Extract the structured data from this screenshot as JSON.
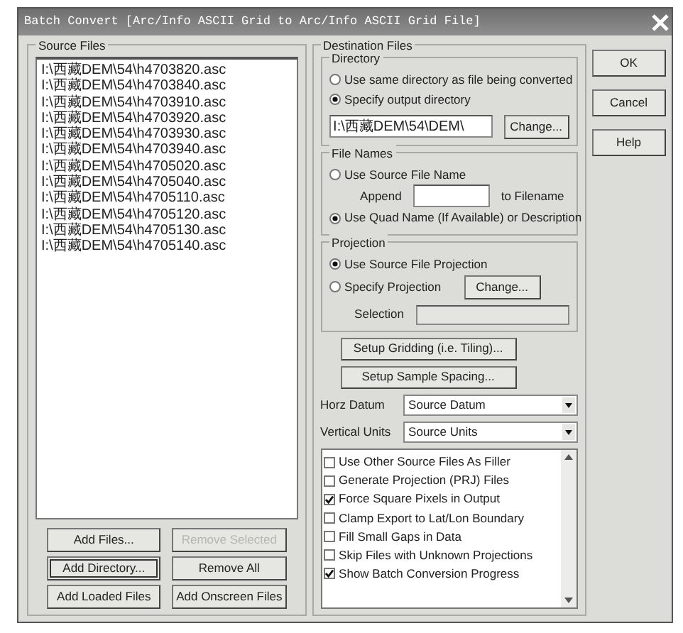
{
  "window": {
    "title": "Batch Convert [Arc/Info ASCII Grid to Arc/Info ASCII Grid File]"
  },
  "source_files": {
    "label": "Source Files",
    "files": [
      "I:\\西藏DEM\\54\\h4703820.asc",
      "I:\\西藏DEM\\54\\h4703840.asc",
      "I:\\西藏DEM\\54\\h4703910.asc",
      "I:\\西藏DEM\\54\\h4703920.asc",
      "I:\\西藏DEM\\54\\h4703930.asc",
      "I:\\西藏DEM\\54\\h4703940.asc",
      "I:\\西藏DEM\\54\\h4705020.asc",
      "I:\\西藏DEM\\54\\h4705040.asc",
      "I:\\西藏DEM\\54\\h4705110.asc",
      "I:\\西藏DEM\\54\\h4705120.asc",
      "I:\\西藏DEM\\54\\h4705130.asc",
      "I:\\西藏DEM\\54\\h4705140.asc"
    ],
    "buttons": [
      {
        "label": "Add Files...",
        "disabled": false,
        "focused": false
      },
      {
        "label": "Remove Selected",
        "disabled": true,
        "focused": false
      },
      {
        "label": "Add Directory...",
        "disabled": false,
        "focused": true
      },
      {
        "label": "Remove All",
        "disabled": false,
        "focused": false
      },
      {
        "label": "Add Loaded Files",
        "disabled": false,
        "focused": false
      },
      {
        "label": "Add Onscreen Files",
        "disabled": false,
        "focused": false
      }
    ]
  },
  "destination": {
    "label": "Destination Files",
    "directory": {
      "label": "Directory",
      "options": [
        {
          "label": "Use same directory as file being converted",
          "selected": false
        },
        {
          "label": "Specify output directory",
          "selected": true
        }
      ],
      "path": "I:\\西藏DEM\\54\\DEM\\",
      "change_button": "Change..."
    },
    "file_names": {
      "label": "File Names",
      "options": [
        {
          "label": "Use Source File Name",
          "selected": false
        },
        {
          "label": "Use Quad Name (If Available) or Description",
          "selected": true
        }
      ],
      "append_label": "Append",
      "append_suffix": "to Filename"
    },
    "projection": {
      "label": "Projection",
      "options": [
        {
          "label": "Use Source File Projection",
          "selected": true
        },
        {
          "label": "Specify Projection",
          "selected": false
        }
      ],
      "change_button": "Change...",
      "selection_label": "Selection"
    },
    "gridding_button": "Setup Gridding (i.e. Tiling)...",
    "spacing_button": "Setup Sample Spacing...",
    "horz_datum": {
      "label": "Horz Datum",
      "value": "Source Datum"
    },
    "vertical_units": {
      "label": "Vertical Units",
      "value": "Source Units"
    },
    "options": [
      {
        "label": "Use Other Source Files As Filler",
        "checked": false
      },
      {
        "label": "Generate Projection (PRJ) Files",
        "checked": false
      },
      {
        "label": "Force Square Pixels in Output",
        "checked": true
      },
      {
        "label": "Clamp Export to Lat/Lon Boundary",
        "checked": false
      },
      {
        "label": "Fill Small Gaps in Data",
        "checked": false
      },
      {
        "label": "Skip Files with Unknown Projections",
        "checked": false
      },
      {
        "label": "Show Batch Conversion Progress",
        "checked": true
      }
    ]
  },
  "dialog_buttons": [
    "OK",
    "Cancel",
    "Help"
  ]
}
